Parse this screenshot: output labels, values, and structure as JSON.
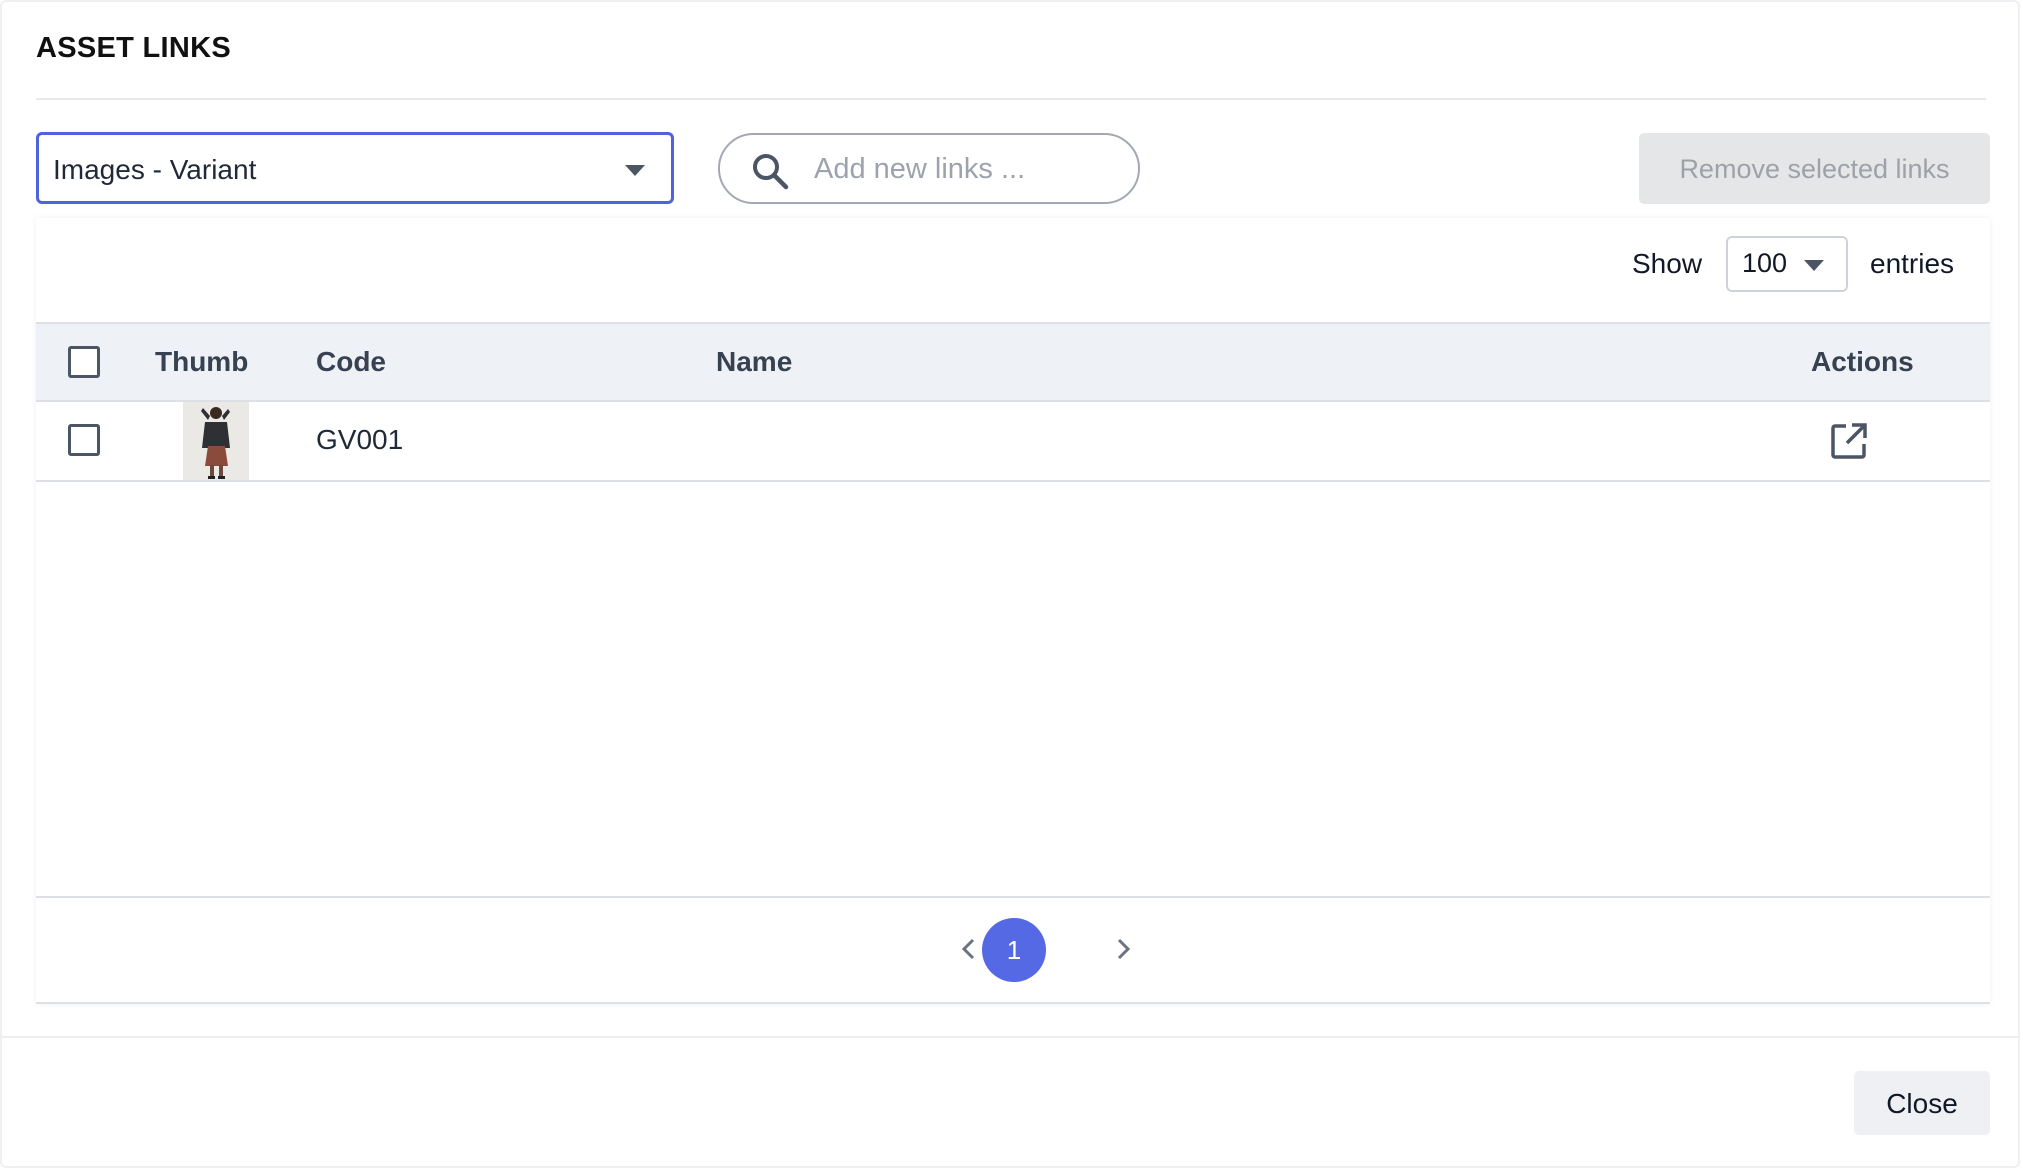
{
  "modal": {
    "title": "ASSET LINKS"
  },
  "toolbar": {
    "link_type": {
      "selected": "Images - Variant",
      "icon": "chevron-down-icon"
    },
    "search": {
      "placeholder": "Add new links ...",
      "value": "",
      "icon": "search-icon"
    },
    "remove_label": "Remove selected links"
  },
  "table": {
    "show_label": "Show",
    "entries_value": "100",
    "entries_label": "entries",
    "columns": {
      "thumb": "Thumb",
      "code": "Code",
      "name": "Name",
      "actions": "Actions"
    },
    "rows": [
      {
        "code": "GV001",
        "name": "",
        "action_icon": "open-external-icon"
      }
    ]
  },
  "pagination": {
    "current_page": "1",
    "prev_icon": "chevron-left-icon",
    "next_icon": "chevron-right-icon"
  },
  "footer": {
    "close_label": "Close"
  },
  "colors": {
    "accent": "#5469e3",
    "select_border": "#4f63df",
    "header_bg": "#eef1f5",
    "disabled_button_bg": "#e5e6e8"
  }
}
